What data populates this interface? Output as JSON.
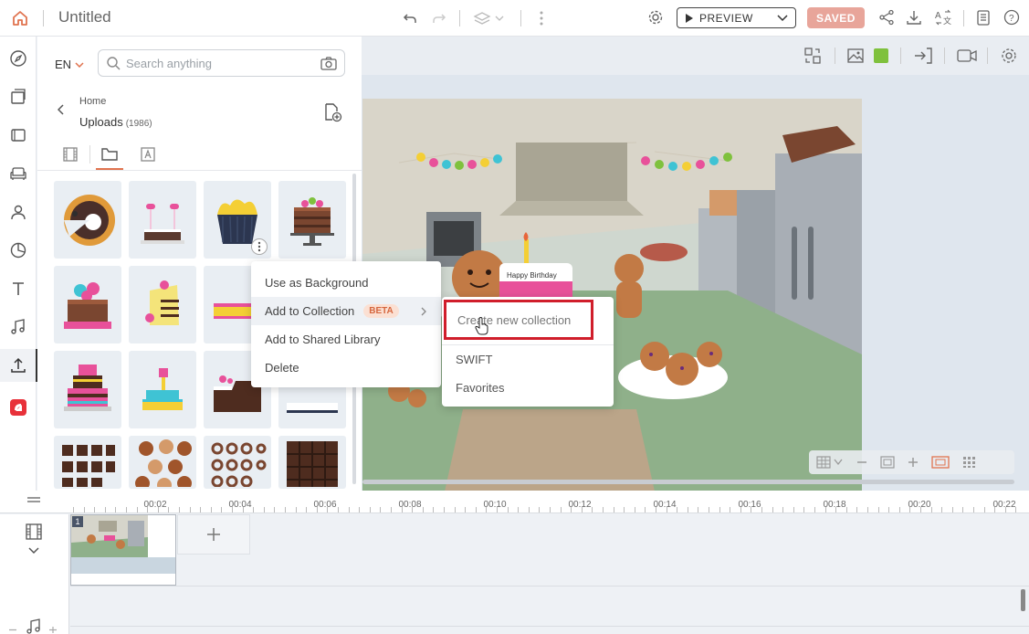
{
  "app": {
    "title": "Untitled"
  },
  "topbar": {
    "preview_label": "PREVIEW",
    "saved_label": "SAVED"
  },
  "panel": {
    "language": "EN",
    "search_placeholder": "Search anything",
    "breadcrumb_home": "Home",
    "breadcrumb_current": "Uploads",
    "breadcrumb_count": "(1986)"
  },
  "context_menu": {
    "items": [
      {
        "label": "Use as Background"
      },
      {
        "label": "Add to Collection",
        "badge": "BETA"
      },
      {
        "label": "Add to Shared Library"
      },
      {
        "label": "Delete"
      }
    ]
  },
  "submenu": {
    "create_label": "Create new collection",
    "items": [
      {
        "label": "SWIFT"
      },
      {
        "label": "Favorites"
      }
    ]
  },
  "scene": {
    "sign_text": "Happy Birthday"
  },
  "timeline": {
    "ticks": [
      "00:02",
      "00:04",
      "00:06",
      "00:08",
      "00:10",
      "00:12",
      "00:14",
      "00:16",
      "00:18",
      "00:20",
      "00:22"
    ],
    "scene_number": "1"
  },
  "colors": {
    "accent": "#e0734f",
    "saved_bg": "#e8a59a",
    "highlight_border": "#d01e2b",
    "brand_red": "#e8313a",
    "scene_green": "#7fc13d"
  }
}
